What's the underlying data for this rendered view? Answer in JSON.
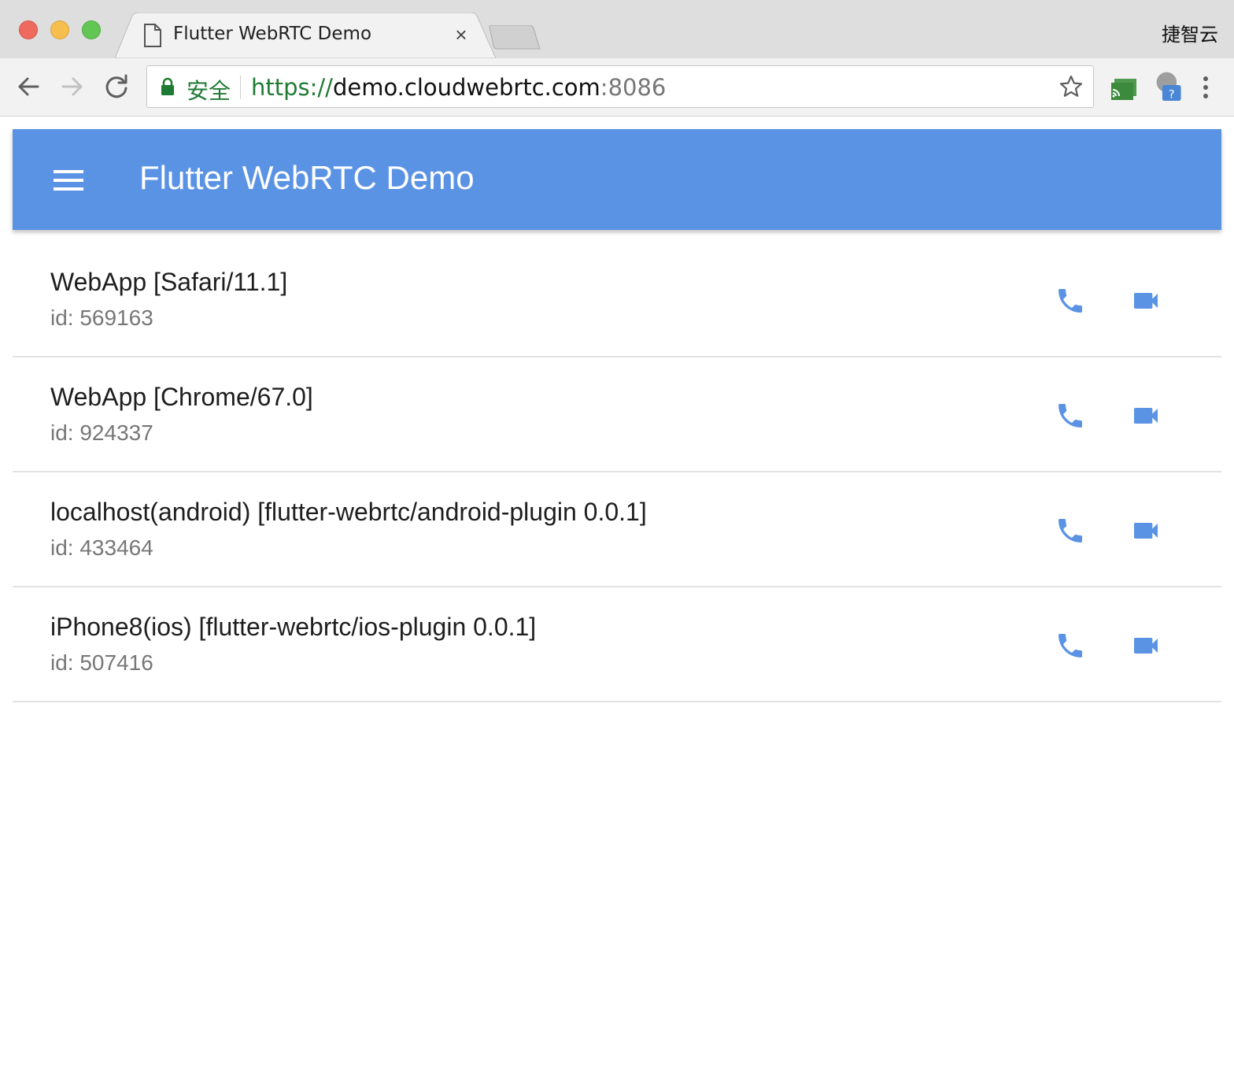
{
  "browser": {
    "tab": {
      "title": "Flutter WebRTC Demo",
      "close_glyph": "×"
    },
    "user_label": "捷智云",
    "omnibox": {
      "secure_label": "安全",
      "url_scheme": "https://",
      "url_host": "demo.cloudwebrtc.com",
      "url_port": ":8086"
    },
    "icons": [
      "back-arrow-icon",
      "forward-arrow-icon",
      "reload-icon",
      "lock-icon",
      "star-icon",
      "cast-icon",
      "profile-help-icon",
      "menu-dots-icon",
      "document-icon",
      "close-icon"
    ]
  },
  "app": {
    "title": "Flutter WebRTC Demo",
    "accent_color": "#5b93e4",
    "peers": [
      {
        "name": "WebApp [Safari/11.1]",
        "id": "id: 569163"
      },
      {
        "name": "WebApp [Chrome/67.0]",
        "id": "id: 924337"
      },
      {
        "name": "localhost(android) [flutter-webrtc/android-plugin 0.0.1]",
        "id": "id: 433464"
      },
      {
        "name": "iPhone8(ios) [flutter-webrtc/ios-plugin 0.0.1]",
        "id": "id: 507416"
      }
    ]
  }
}
